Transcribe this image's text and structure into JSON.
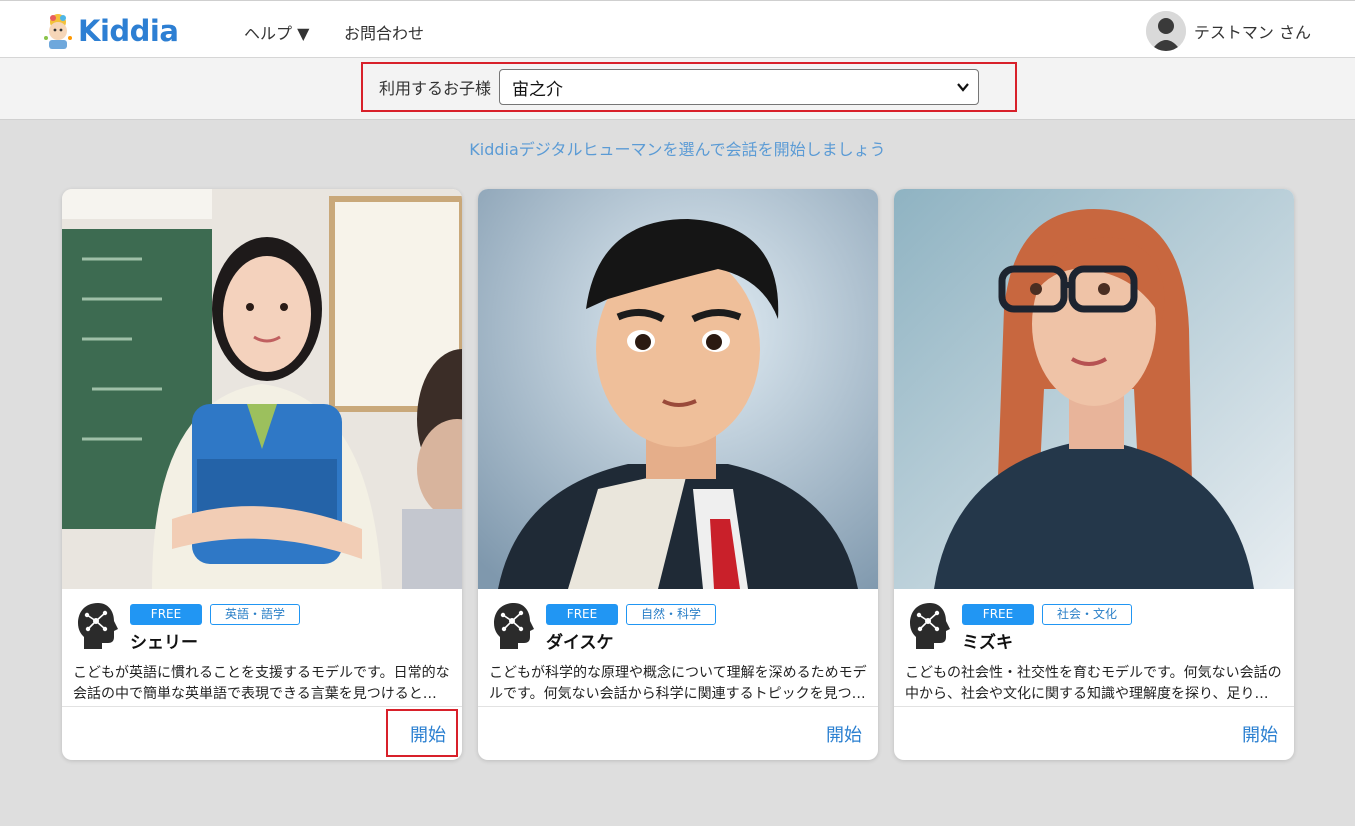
{
  "header": {
    "logo_text": "Kiddia",
    "nav": {
      "help": "ヘルプ ▼",
      "contact": "お問合わせ"
    },
    "user_name": "テストマン さん"
  },
  "selector": {
    "label": "利用するお子様",
    "value": "宙之介"
  },
  "subtitle": "Kiddiaデジタルヒューマンを選んで会話を開始しましょう",
  "cards": [
    {
      "badge": "FREE",
      "category": "英語・語学",
      "name": "シェリー",
      "desc": "こどもが英語に慣れることを支援するモデルです。日常的な会話の中で簡単な英単語で表現できる言葉を見つけると…",
      "start": "開始"
    },
    {
      "badge": "FREE",
      "category": "自然・科学",
      "name": "ダイスケ",
      "desc": "こどもが科学的な原理や概念について理解を深めるためモデルです。何気ない会話から科学に関連するトピックを見つ…",
      "start": "開始"
    },
    {
      "badge": "FREE",
      "category": "社会・文化",
      "name": "ミズキ",
      "desc": "こどもの社会性・社交性を育むモデルです。何気ない会話の中から、社会や文化に関する知識や理解度を探り、足り…",
      "start": "開始"
    }
  ],
  "colors": {
    "accent": "#2196f3",
    "link": "#2a7fd0",
    "highlight": "#d8202a",
    "logo": "#2d7fd3"
  }
}
